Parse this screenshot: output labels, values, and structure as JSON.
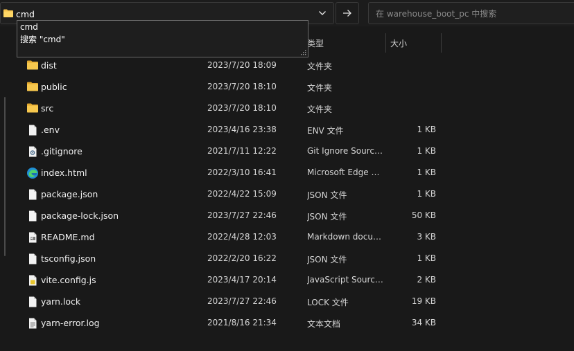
{
  "address_bar": {
    "value": "cmd"
  },
  "search": {
    "placeholder": "在 warehouse_boot_pc 中搜索"
  },
  "suggestions": [
    {
      "label": "cmd"
    },
    {
      "label": "搜索 \"cmd\""
    }
  ],
  "columns": {
    "type": "类型",
    "size": "大小"
  },
  "files": [
    {
      "name": "dist",
      "modified": "2023/7/20 18:09",
      "type": "文件夹",
      "size": "",
      "icon": "folder-icon"
    },
    {
      "name": "public",
      "modified": "2023/7/20 18:10",
      "type": "文件夹",
      "size": "",
      "icon": "folder-icon"
    },
    {
      "name": "src",
      "modified": "2023/7/20 18:10",
      "type": "文件夹",
      "size": "",
      "icon": "folder-icon"
    },
    {
      "name": ".env",
      "modified": "2023/4/16 23:38",
      "type": "ENV 文件",
      "size": "1 KB",
      "icon": "file-icon"
    },
    {
      "name": ".gitignore",
      "modified": "2021/7/11 12:22",
      "type": "Git Ignore Source File",
      "size": "1 KB",
      "icon": "gear-file-icon"
    },
    {
      "name": "index.html",
      "modified": "2022/3/10 16:41",
      "type": "Microsoft Edge HTML Document",
      "size": "1 KB",
      "icon": "edge-icon"
    },
    {
      "name": "package.json",
      "modified": "2022/4/22 15:09",
      "type": "JSON 文件",
      "size": "1 KB",
      "icon": "file-icon"
    },
    {
      "name": "package-lock.json",
      "modified": "2023/7/27 22:46",
      "type": "JSON 文件",
      "size": "50 KB",
      "icon": "file-icon"
    },
    {
      "name": "README.md",
      "modified": "2022/4/28 12:03",
      "type": "Markdown document",
      "size": "3 KB",
      "icon": "markdown-file-icon"
    },
    {
      "name": "tsconfig.json",
      "modified": "2022/2/20 16:22",
      "type": "JSON 文件",
      "size": "1 KB",
      "icon": "file-icon"
    },
    {
      "name": "vite.config.js",
      "modified": "2023/4/17 20:14",
      "type": "JavaScript Source File",
      "size": "2 KB",
      "icon": "js-file-icon"
    },
    {
      "name": "yarn.lock",
      "modified": "2023/7/27 22:46",
      "type": "LOCK 文件",
      "size": "19 KB",
      "icon": "file-icon"
    },
    {
      "name": "yarn-error.log",
      "modified": "2021/8/16 21:34",
      "type": "文本文档",
      "size": "34 KB",
      "icon": "text-file-icon"
    }
  ],
  "colors": {
    "folder": "#f4c24b",
    "background": "#191919",
    "text": "#e6e6e6"
  }
}
